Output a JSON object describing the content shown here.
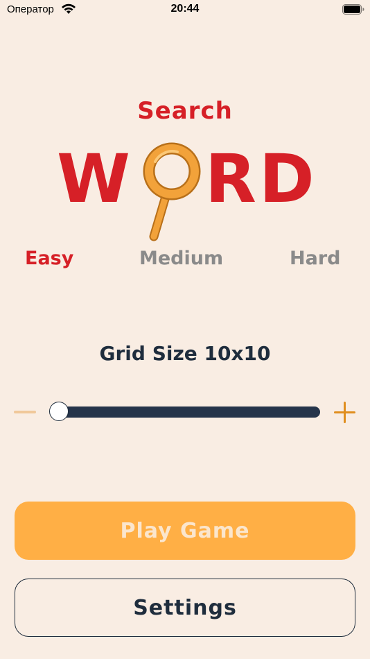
{
  "status_bar": {
    "carrier": "Оператор",
    "time": "20:44"
  },
  "logo": {
    "search": "Search",
    "word_w": "W",
    "word_r": "R",
    "word_d": "D"
  },
  "difficulty": {
    "options": [
      "Easy",
      "Medium",
      "Hard"
    ],
    "selected": "Easy"
  },
  "grid_size": {
    "label": "Grid Size 10x10",
    "slider_level": 0
  },
  "buttons": {
    "play": "Play Game",
    "settings": "Settings"
  },
  "colors": {
    "background": "#f9ede3",
    "accent_red": "#d62027",
    "accent_orange": "#ffaf45",
    "dark_navy": "#1f2d3d",
    "muted_gray": "#8a8a8a"
  },
  "icons": {
    "wifi": "wifi-icon",
    "battery": "battery-icon",
    "magnifier": "magnifier-icon",
    "minus": "minus-icon",
    "plus": "plus-icon"
  }
}
